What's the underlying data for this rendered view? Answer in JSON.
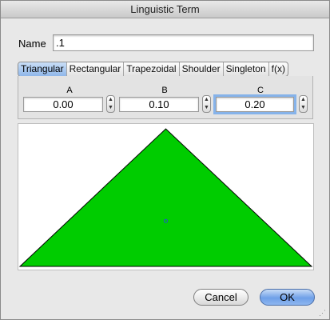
{
  "window": {
    "title": "Linguistic Term"
  },
  "name": {
    "label": "Name",
    "value": ".1"
  },
  "tabs": [
    {
      "label": "Triangular",
      "active": true
    },
    {
      "label": "Rectangular",
      "active": false
    },
    {
      "label": "Trapezoidal",
      "active": false
    },
    {
      "label": "Shoulder",
      "active": false
    },
    {
      "label": "Singleton",
      "active": false
    },
    {
      "label": "f(x)",
      "active": false
    }
  ],
  "params": {
    "a": {
      "label": "A",
      "value": "0.00"
    },
    "b": {
      "label": "B",
      "value": "0.10"
    },
    "c": {
      "label": "C",
      "value": "0.20"
    }
  },
  "chart_data": {
    "type": "area",
    "x": [
      0.0,
      0.1,
      0.2
    ],
    "y": [
      0,
      1,
      0
    ],
    "fill_color": "#00cc00",
    "marker": {
      "x": 0.1,
      "y": 0.33
    }
  },
  "buttons": {
    "cancel": "Cancel",
    "ok": "OK"
  },
  "colors": {
    "accent": "#6fa0e8",
    "shape_fill": "#00cc00"
  }
}
